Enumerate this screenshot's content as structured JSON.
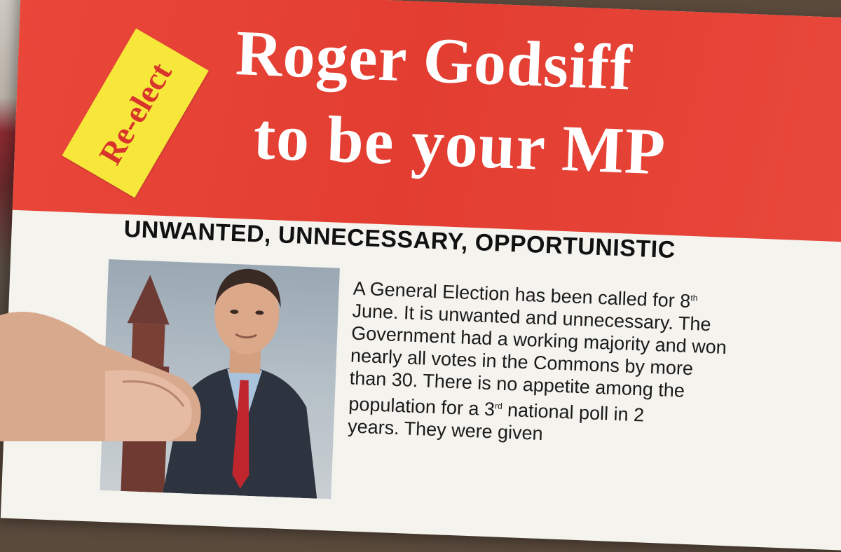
{
  "leaflet": {
    "badge_text": "Re-elect",
    "title_line1": "Roger Godsiff",
    "title_line2": "to be your MP",
    "headline": "UNWANTED, UNNECESSARY, OPPORTUNISTIC",
    "body_lines": [
      "A General Election has been called for 8",
      "June. It is unwanted and unnecessary. The",
      "Government had a working majority and won",
      "nearly all votes in the Commons by more",
      "than 30. There is no appetite among the",
      "population for a 3",
      "years. They were given"
    ],
    "sup_th": "th",
    "sup_rd": "rd",
    "line6_rest": " national poll in 2"
  },
  "colors": {
    "header_red": "#e33d31",
    "badge_yellow": "#f6e73a",
    "paper": "#f4f3ee"
  }
}
